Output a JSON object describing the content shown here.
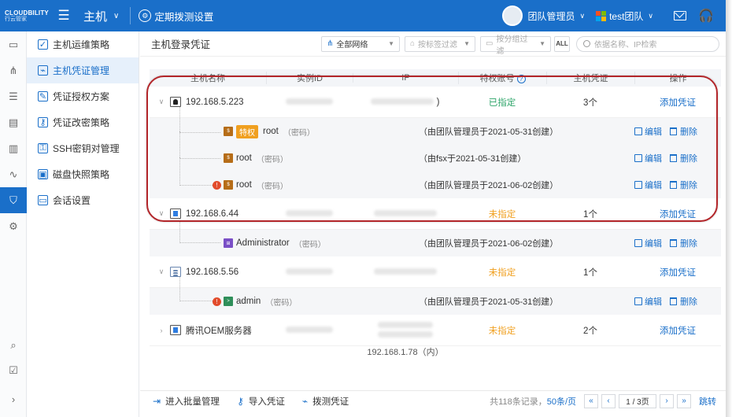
{
  "app": {
    "logo_text": "CLOUDBILITY",
    "logo_sub": "行云管家",
    "module": "主机",
    "schedule_label": "定期拨测设置",
    "user": "团队管理员",
    "team": "test团队"
  },
  "rail_icons": [
    "monitor-icon",
    "topology-icon",
    "list-icon",
    "clipboard-icon",
    "clipboard-check-icon",
    "pulse-icon",
    "shield-gear-icon",
    "settings-icon"
  ],
  "submenu": [
    {
      "label": "主机运维策略",
      "icon": "shield-icon"
    },
    {
      "label": "主机凭证管理",
      "icon": "credential-icon",
      "active": true
    },
    {
      "label": "凭证授权方案",
      "icon": "doc-edit-icon"
    },
    {
      "label": "凭证改密策略",
      "icon": "key-edit-icon"
    },
    {
      "label": "SSH密钥对管理",
      "icon": "ssh-key-icon"
    },
    {
      "label": "磁盘快照策略",
      "icon": "disk-icon"
    },
    {
      "label": "会话设置",
      "icon": "window-icon"
    }
  ],
  "page": {
    "title": "主机登录凭证",
    "network_filter": "全部网络",
    "tag_filter_placeholder": "按标签过滤",
    "group_filter_placeholder": "按分组过滤",
    "all_label": "ALL",
    "search_placeholder": "依据名称、IP检索"
  },
  "table": {
    "columns": [
      "主机名称",
      "实例ID",
      "IP",
      "特权账号",
      "主机凭证",
      "操作"
    ],
    "hosts": [
      {
        "name": "192.168.5.223",
        "ip_suffix": ")",
        "privileged": "已指定",
        "cred_count": "3个",
        "action": "添加凭证",
        "creds": [
          {
            "tag": "特权",
            "name": "root",
            "pw": "（密码）",
            "origin": "（由团队管理员于2021-05-31创建）"
          },
          {
            "name": "root",
            "pw": "（密码）",
            "origin": "（由fsx于2021-05-31创建）"
          },
          {
            "name": "root",
            "pw": "（密码）",
            "origin": "（由团队管理员于2021-06-02创建）",
            "warn": true
          }
        ]
      },
      {
        "name": "192.168.6.44",
        "privileged": "未指定",
        "cred_count": "1个",
        "action": "添加凭证",
        "creds": [
          {
            "name": "Administrator",
            "pw": "（密码）",
            "origin": "（由团队管理员于2021-06-02创建）"
          }
        ]
      },
      {
        "name": "192.168.5.56",
        "privileged": "未指定",
        "cred_count": "1个",
        "action": "添加凭证",
        "creds": [
          {
            "name": "admin",
            "pw": "（密码）",
            "origin": "（由团队管理员于2021-05-31创建）",
            "warn": true
          }
        ]
      },
      {
        "name": "腾讯OEM服务器",
        "privileged": "未指定",
        "cred_count": "2个",
        "action": "添加凭证"
      }
    ],
    "partial_row_ip": "192.168.1.78（内）",
    "edit_label": "编辑",
    "delete_label": "删除"
  },
  "footer": {
    "batch": "进入批量管理",
    "import": "导入凭证",
    "probe": "拨测凭证",
    "total": "共118条记录，",
    "per_page": "50条/页",
    "page": "1 / 3页",
    "jump": "跳转"
  }
}
